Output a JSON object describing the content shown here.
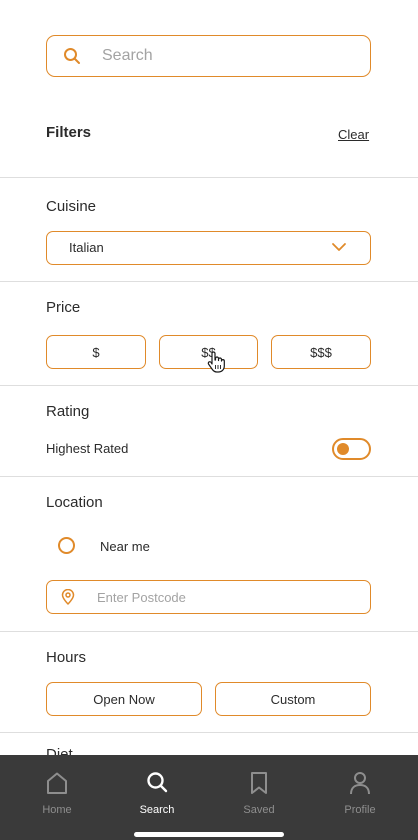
{
  "search": {
    "placeholder": "Search",
    "icon": "search-icon"
  },
  "filters": {
    "title": "Filters",
    "clear_label": "Clear"
  },
  "cuisine": {
    "title": "Cuisine",
    "selected": "Italian"
  },
  "price": {
    "title": "Price",
    "options": [
      "$",
      "$$",
      "$$$"
    ]
  },
  "rating": {
    "title": "Rating",
    "highest_label": "Highest Rated",
    "highest_enabled": false
  },
  "location": {
    "title": "Location",
    "near_me_label": "Near me",
    "postcode_placeholder": "Enter Postcode"
  },
  "hours": {
    "title": "Hours",
    "options": [
      "Open Now",
      "Custom"
    ]
  },
  "next_section_partial": "Diet",
  "tabs": [
    {
      "label": "Home",
      "icon": "home-icon",
      "active": false
    },
    {
      "label": "Search",
      "icon": "search-icon",
      "active": true
    },
    {
      "label": "Saved",
      "icon": "bookmark-icon",
      "active": false
    },
    {
      "label": "Profile",
      "icon": "person-icon",
      "active": false
    }
  ],
  "colors": {
    "accent": "#e08a2a",
    "tabbar": "#3a3a3a",
    "divider": "#dedede"
  }
}
